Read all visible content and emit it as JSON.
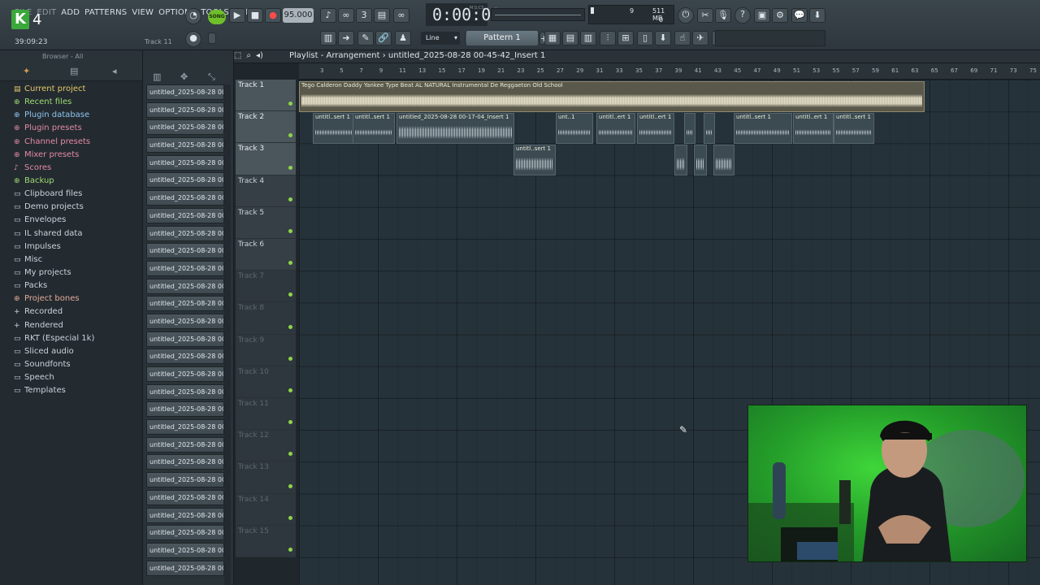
{
  "app": {
    "version_badge": "4",
    "menu": [
      "FILE",
      "EDIT",
      "ADD",
      "PATTERNS",
      "VIEW",
      "OPTIONS",
      "TOOLS",
      "HELP"
    ],
    "clock": "39:09:23",
    "hint_track": "Track 11",
    "tempo": "95.000",
    "song_label": "SONG",
    "time_display": "0:00:00",
    "time_unit": "M:S:CS",
    "cpu_polyphony": "9",
    "cpu_memory": "511 MB",
    "cpu_zero": "0",
    "snap_label": "Line",
    "pattern_name": "Pattern 1"
  },
  "browser": {
    "header": "Browser - All",
    "items": [
      {
        "label": "Current project",
        "color": "yellow",
        "icon": "project-icon"
      },
      {
        "label": "Recent files",
        "color": "green",
        "icon": "recent-icon"
      },
      {
        "label": "Plugin database",
        "color": "blue",
        "icon": "plugin-db-icon"
      },
      {
        "label": "Plugin presets",
        "color": "pink",
        "icon": "plugin-presets-icon"
      },
      {
        "label": "Channel presets",
        "color": "pink",
        "icon": "channel-presets-icon"
      },
      {
        "label": "Mixer presets",
        "color": "pink",
        "icon": "mixer-presets-icon"
      },
      {
        "label": "Scores",
        "color": "pink",
        "icon": "scores-icon"
      },
      {
        "label": "Backup",
        "color": "green",
        "icon": "backup-icon"
      },
      {
        "label": "Clipboard files",
        "color": "white",
        "icon": "folder-icon"
      },
      {
        "label": "Demo projects",
        "color": "white",
        "icon": "folder-icon"
      },
      {
        "label": "Envelopes",
        "color": "white",
        "icon": "folder-icon"
      },
      {
        "label": "IL shared data",
        "color": "white",
        "icon": "folder-icon"
      },
      {
        "label": "Impulses",
        "color": "white",
        "icon": "folder-icon"
      },
      {
        "label": "Misc",
        "color": "white",
        "icon": "folder-icon"
      },
      {
        "label": "My projects",
        "color": "white",
        "icon": "folder-icon"
      },
      {
        "label": "Packs",
        "color": "white",
        "icon": "folder-icon"
      },
      {
        "label": "Project bones",
        "color": "peach",
        "icon": "bones-icon"
      },
      {
        "label": "Recorded",
        "color": "white",
        "icon": "recorded-icon"
      },
      {
        "label": "Rendered",
        "color": "white",
        "icon": "rendered-icon"
      },
      {
        "label": "RKT (Especial 1k)",
        "color": "white",
        "icon": "folder-icon"
      },
      {
        "label": "Sliced audio",
        "color": "white",
        "icon": "folder-icon"
      },
      {
        "label": "Soundfonts",
        "color": "white",
        "icon": "folder-icon"
      },
      {
        "label": "Speech",
        "color": "white",
        "icon": "folder-icon"
      },
      {
        "label": "Templates",
        "color": "white",
        "icon": "folder-icon"
      }
    ]
  },
  "picker": {
    "clips": [
      "untitled_2025-08-28 00-",
      "untitled_2025-08-28 00-",
      "untitled_2025-08-28 00-",
      "untitled_2025-08-28 00-",
      "untitled_2025-08-28 00-",
      "untitled_2025-08-28 00-",
      "untitled_2025-08-28 00-",
      "untitled_2025-08-28 00-",
      "untitled_2025-08-28 00-",
      "untitled_2025-08-28 00-",
      "untitled_2025-08-28 00-",
      "untitled_2025-08-28 00-",
      "untitled_2025-08-28 00-",
      "untitled_2025-08-28 00-",
      "untitled_2025-08-28 00-",
      "untitled_2025-08-28 00-",
      "untitled_2025-08-28 00-",
      "untitled_2025-08-28 00-",
      "untitled_2025-08-28 00-",
      "untitled_2025-08-28 00-",
      "untitled_2025-08-28 00-",
      "untitled_2025-08-28 00-",
      "untitled_2025-08-28 00-",
      "untitled_2025-08-28 00-",
      "untitled_2025-08-28 00-",
      "untitled_2025-08-28 00-",
      "untitled_2025-08-28 00-",
      "untitled_2025-08-28 00-"
    ]
  },
  "playlist": {
    "title": "Playlist - Arrangement",
    "breadcrumb": "untitled_2025-08-28 00-45-42_Insert 1",
    "bar_numbers": [
      "3",
      "5",
      "7",
      "9",
      "11",
      "13",
      "15",
      "17",
      "19",
      "21",
      "23",
      "25",
      "27",
      "29",
      "31",
      "33",
      "35",
      "37",
      "39",
      "41",
      "43",
      "45",
      "47",
      "49",
      "51",
      "53",
      "55",
      "57",
      "59",
      "61",
      "63",
      "65",
      "67",
      "69",
      "71",
      "73",
      "75"
    ],
    "tracks": [
      "Track 1",
      "Track 2",
      "Track 3",
      "Track 4",
      "Track 5",
      "Track 6",
      "Track 7",
      "Track 8",
      "Track 9",
      "Track 10",
      "Track 11",
      "Track 12",
      "Track 13",
      "Track 14",
      "Track 15"
    ],
    "clip_names": {
      "main": "Tego Calderon  Daddy Yankee Type Beat AL NATURAL Instrumental De Reggaeton Old School",
      "t2a": "untitl..sert 1",
      "t2b": "untitl..sert 1",
      "t2c": "untitled_2025-08-28 00-17-04_Insert 1",
      "t2d": "unt..1",
      "t2e": "untitl..ert 1",
      "t2f": "untitl..ert 1",
      "t2g": "untitl..sert 1",
      "t2h": "untitl..ert 1",
      "t2i": "untitl..sert 1",
      "t3a": "untitl..sert 1"
    }
  }
}
